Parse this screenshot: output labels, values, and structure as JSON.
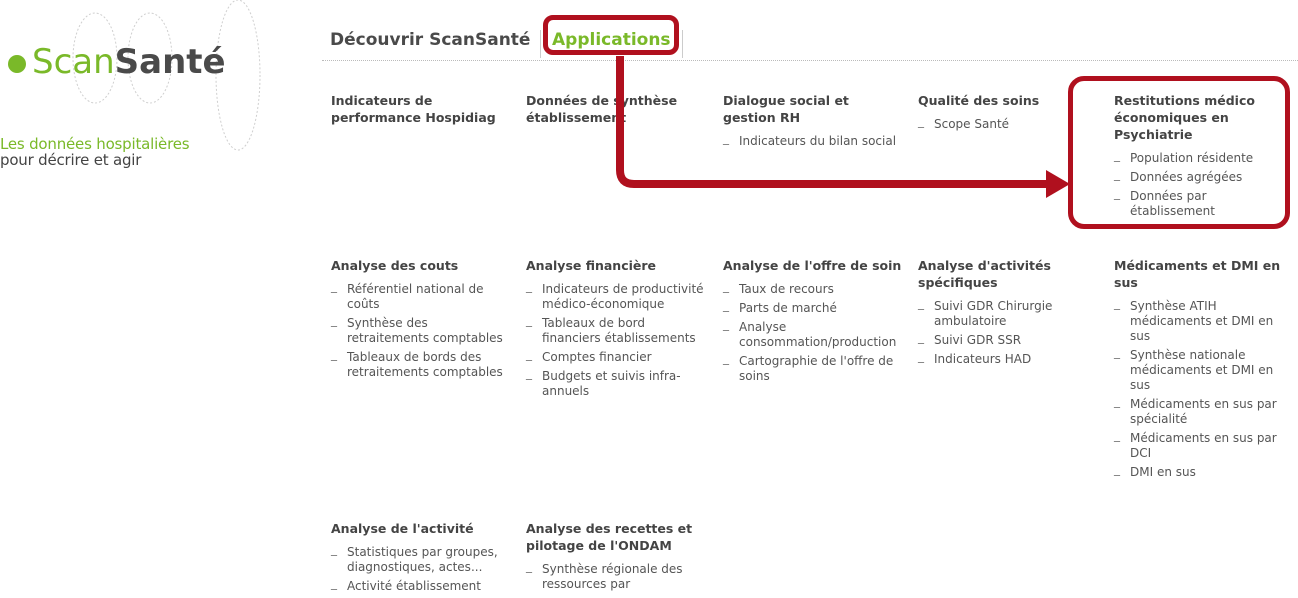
{
  "logo": {
    "scan": "Scan",
    "sante": "Santé",
    "tagline_line1": "Les données hospitalières",
    "tagline_line2": "pour décrire et agir"
  },
  "tabs": [
    {
      "label": "Découvrir ScanSanté"
    },
    {
      "label": "Applications"
    }
  ],
  "sections": [
    {
      "title": "Indicateurs de performance Hospidiag",
      "links": []
    },
    {
      "title": "Données de synthèse établissement",
      "links": []
    },
    {
      "title": "Dialogue social et gestion RH",
      "links": [
        "Indicateurs du bilan social"
      ]
    },
    {
      "title": "Qualité des soins",
      "links": [
        "Scope Santé"
      ]
    },
    {
      "title": "Restitutions médico économiques en Psychiatrie",
      "links": [
        "Population résidente",
        "Données agrégées",
        "Données par établissement"
      ]
    },
    {
      "title": "Analyse des couts",
      "links": [
        "Référentiel national de coûts",
        "Synthèse des retraitements comptables",
        "Tableaux de bords des retraitements comptables"
      ]
    },
    {
      "title": "Analyse financière",
      "links": [
        "Indicateurs de productivité médico-économique",
        "Tableaux de bord financiers établissements",
        "Comptes financier",
        "Budgets et suivis infra-annuels"
      ]
    },
    {
      "title": "Analyse de l'offre de soin",
      "links": [
        "Taux de recours",
        "Parts de marché",
        "Analyse consommation/production",
        "Cartographie de l'offre de soins"
      ]
    },
    {
      "title": "Analyse d'activités spécifiques",
      "links": [
        "Suivi GDR Chirurgie ambulatoire",
        "Suivi GDR SSR",
        "Indicateurs HAD"
      ]
    },
    {
      "title": "Médicaments et DMI en sus",
      "links": [
        "Synthèse ATIH médicaments et DMI en sus",
        "Synthèse nationale médicaments et DMI en sus",
        "Médicaments en sus par spécialité",
        "Médicaments en sus par DCI",
        "DMI en sus"
      ]
    },
    {
      "title": "Analyse de l'activité",
      "links": [
        "Statistiques par groupes, diagnostiques, actes...",
        "Activité établissement"
      ]
    },
    {
      "title": "Analyse des recettes et pilotage de l'ONDAM",
      "links": [
        "Synthèse régionale des ressources par"
      ]
    }
  ],
  "colors": {
    "brand_green": "#7ab929",
    "highlight_red": "#b0101e"
  }
}
